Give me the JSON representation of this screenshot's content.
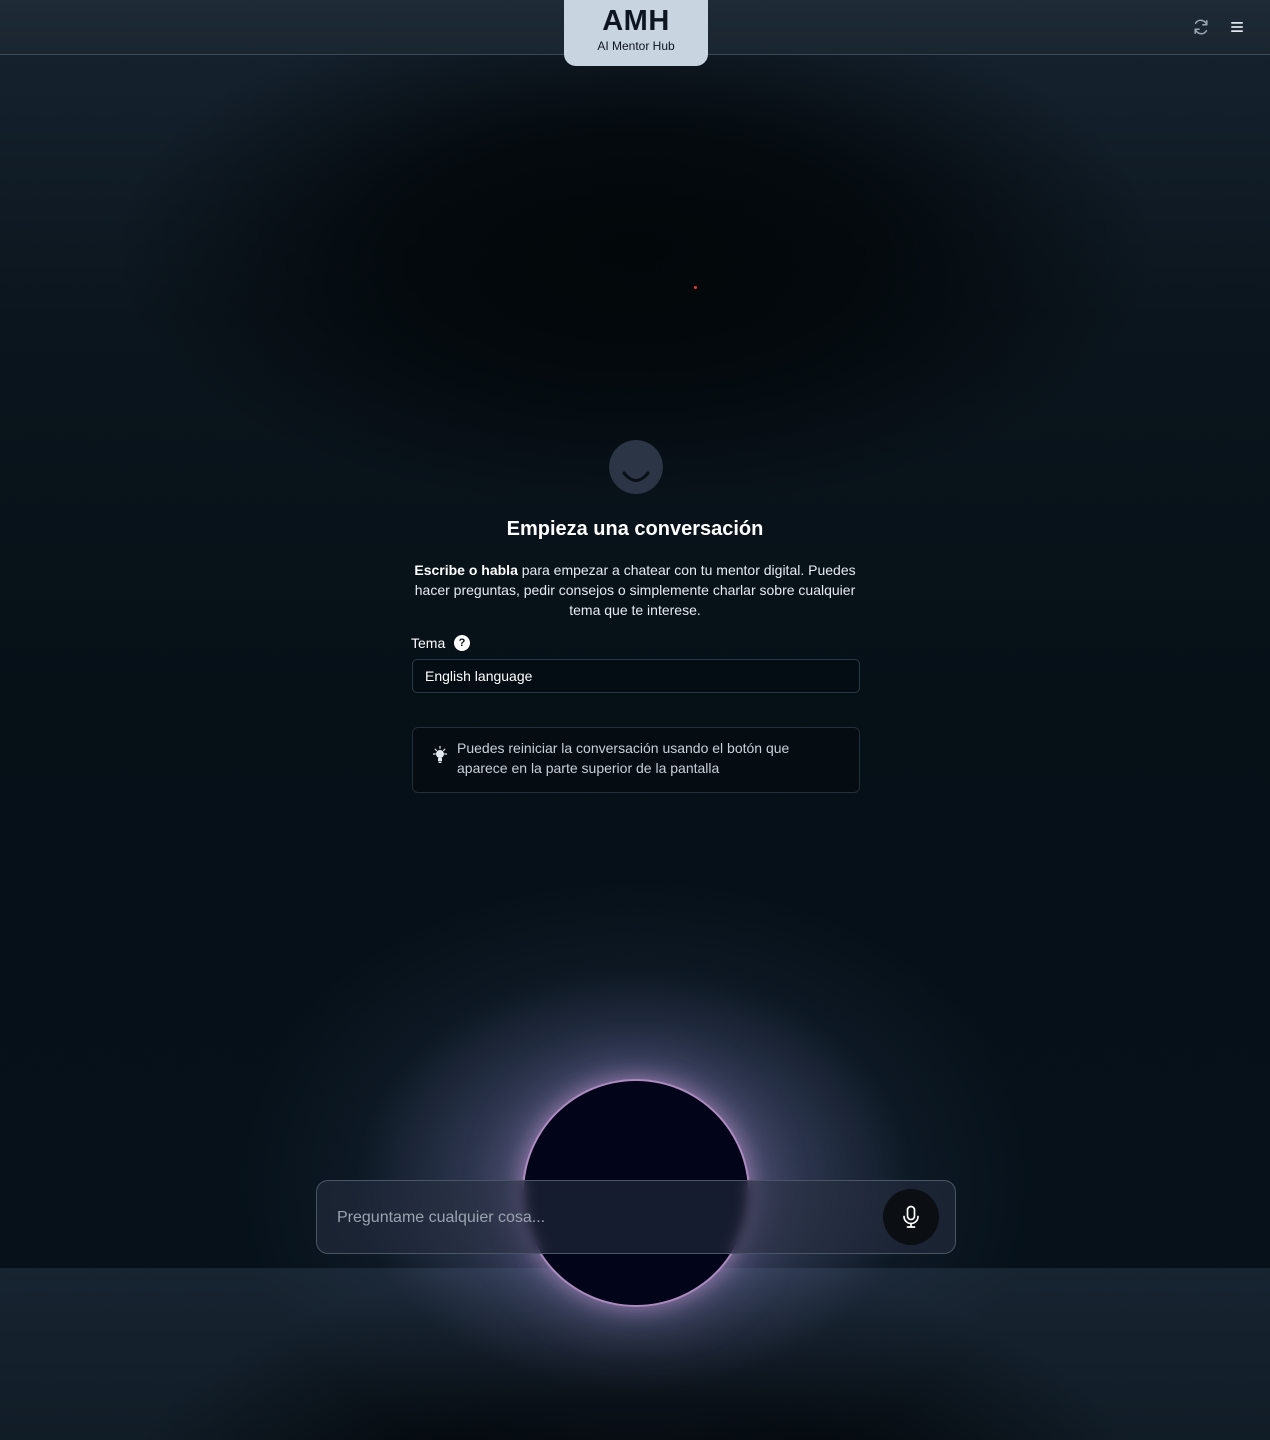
{
  "app": {
    "logo_title": "AMH",
    "logo_subtitle": "AI Mentor Hub"
  },
  "header": {
    "icons": [
      "refresh-icon",
      "menu-icon"
    ]
  },
  "empty_state": {
    "heading": "Empieza una conversación",
    "desc_bold": "Escribe o habla",
    "desc_rest": " para empezar a chatear con tu mentor digital. Puedes hacer preguntas, pedir consejos o simplemente charlar sobre cualquier tema que te interese."
  },
  "topic": {
    "label": "Tema",
    "help_glyph": "?",
    "value": "English language"
  },
  "tip": {
    "icon": "lightbulb-icon",
    "text": "Puedes reiniciar la conversación usando el botón que aparece en la parte superior de la pantalla"
  },
  "chat": {
    "placeholder": "Preguntame cualquier cosa...",
    "mic_icon": "microphone-icon"
  },
  "colors": {
    "logo_bg": "#c9d4e1",
    "orb_rim": "#dcaae6",
    "background": "#061017"
  }
}
